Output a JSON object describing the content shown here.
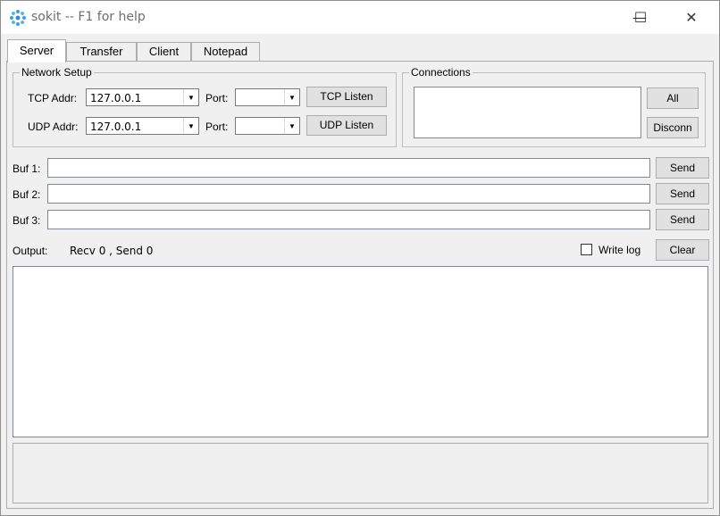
{
  "window": {
    "title": "sokit -- F1 for help",
    "controls": {
      "minimize": "—",
      "maximize": "☐",
      "close": "✕"
    }
  },
  "tabs": [
    {
      "label": "Server",
      "active": true
    },
    {
      "label": "Transfer",
      "active": false
    },
    {
      "label": "Client",
      "active": false
    },
    {
      "label": "Notepad",
      "active": false
    }
  ],
  "network_setup": {
    "title": "Network Setup",
    "tcp": {
      "addr_label": "TCP Addr:",
      "addr_value": "127.0.0.1",
      "port_label": "Port:",
      "port_value": "",
      "button": "TCP Listen"
    },
    "udp": {
      "addr_label": "UDP Addr:",
      "addr_value": "127.0.0.1",
      "port_label": "Port:",
      "port_value": "",
      "button": "UDP Listen"
    }
  },
  "connections": {
    "title": "Connections",
    "all_button": "All",
    "disconn_button": "Disconn"
  },
  "buffers": [
    {
      "label": "Buf 1:",
      "value": "",
      "send": "Send"
    },
    {
      "label": "Buf 2:",
      "value": "",
      "send": "Send"
    },
    {
      "label": "Buf 3:",
      "value": "",
      "send": "Send"
    }
  ],
  "output": {
    "label": "Output:",
    "status": "Recv 0 , Send 0",
    "write_log_label": "Write log",
    "write_log_checked": false,
    "clear_button": "Clear"
  },
  "colors": {
    "accent_icon": "#3aa0e0",
    "window_bg": "#f0f0f0"
  },
  "icons": {
    "app": "app-logo-icon",
    "dropdown": "chevron-down-icon"
  }
}
